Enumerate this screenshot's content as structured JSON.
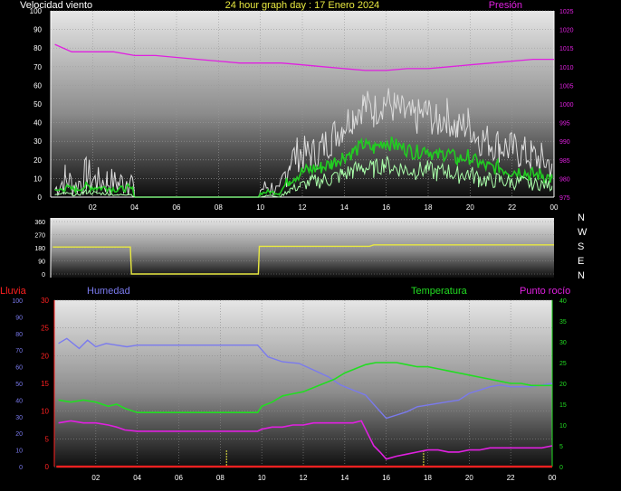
{
  "colors": {
    "background": "#000000",
    "wind_text": "#ffffff",
    "pressure": "#e020e0",
    "wind_speed": "#ffffff",
    "wind_gust": "#dcdcdc",
    "wind_avg": "#22cc22",
    "wind_low": "#aaffaa",
    "direction": "#e8e840",
    "rain": "#ff2020",
    "humidity": "#7a7aee",
    "temperature": "#22dd22",
    "dewpoint": "#e020e0",
    "title": "#e8e840"
  },
  "chart_data": [
    {
      "type": "line",
      "title": "24 hour graph day : 17 Enero 2024",
      "left_label": "Velocidad viento",
      "right_label": "Presión",
      "x_ticks": [
        "02",
        "04",
        "06",
        "08",
        "10",
        "12",
        "14",
        "16",
        "18",
        "20",
        "22",
        "00"
      ],
      "ylim": [
        0,
        100
      ],
      "y_ticks": [
        0,
        10,
        20,
        30,
        40,
        50,
        60,
        70,
        80,
        90,
        100
      ],
      "y2lim": [
        975,
        1025
      ],
      "y2_ticks": [
        975,
        980,
        985,
        990,
        995,
        1000,
        1005,
        1010,
        1015,
        1020,
        1025
      ],
      "series": [
        {
          "name": "Presión",
          "axis": "right",
          "x": [
            0.2,
            1,
            2,
            3,
            4,
            5,
            6,
            7,
            8,
            9,
            10,
            11,
            12,
            13,
            14,
            15,
            16,
            17,
            18,
            19,
            20,
            21,
            22,
            23,
            24
          ],
          "y": [
            1016,
            1014,
            1014,
            1014,
            1013,
            1013,
            1012.5,
            1012,
            1011.5,
            1011,
            1011,
            1011,
            1010.5,
            1010,
            1009.5,
            1009,
            1009,
            1009.5,
            1009.5,
            1010,
            1010.5,
            1011,
            1011.5,
            1012,
            1012
          ]
        },
        {
          "type": "gust",
          "axis": "left",
          "x": [
            0.2,
            0.7,
            1.2,
            1.7,
            2.2,
            2.7,
            3.2,
            3.7,
            3.9,
            4,
            9.9,
            10,
            10.4,
            10.9,
            11.4,
            11.9,
            12.4,
            12.9,
            13.4,
            13.9,
            14.4,
            14.9,
            15.4,
            15.9,
            16.4,
            16.9,
            17.4,
            17.9,
            18.4,
            18.9,
            19.4,
            19.9,
            20.4,
            20.9,
            21.4,
            21.9,
            22.4,
            22.9,
            23.4,
            23.9
          ],
          "y": [
            4,
            10,
            6,
            12,
            8,
            9,
            7,
            10,
            8,
            0,
            0,
            4,
            6,
            3,
            20,
            24,
            22,
            26,
            32,
            38,
            44,
            50,
            46,
            52,
            48,
            44,
            42,
            46,
            40,
            44,
            36,
            40,
            32,
            30,
            28,
            26,
            24,
            22,
            20,
            18
          ]
        },
        {
          "type": "avg",
          "axis": "left",
          "x": [
            0.2,
            0.7,
            1.2,
            1.7,
            2.2,
            2.7,
            3.2,
            3.7,
            3.9,
            4,
            9.9,
            10,
            10.4,
            10.9,
            11.4,
            11.9,
            12.4,
            12.9,
            13.4,
            13.9,
            14.4,
            14.9,
            15.4,
            15.9,
            16.4,
            16.9,
            17.4,
            17.9,
            18.4,
            18.9,
            19.4,
            19.9,
            20.4,
            20.9,
            21.4,
            21.9,
            22.4,
            22.9,
            23.4,
            23.9
          ],
          "y": [
            3,
            5,
            4,
            6,
            5,
            5,
            4,
            5,
            4,
            0,
            0,
            2,
            3,
            2,
            10,
            13,
            15,
            16,
            18,
            22,
            24,
            28,
            26,
            30,
            28,
            26,
            24,
            26,
            22,
            24,
            20,
            22,
            18,
            16,
            16,
            14,
            14,
            12,
            12,
            10
          ]
        },
        {
          "type": "low",
          "axis": "left",
          "x": [
            0.2,
            0.7,
            1.2,
            1.7,
            2.2,
            2.7,
            3.2,
            3.7,
            3.9,
            4,
            9.9,
            10,
            10.4,
            10.9,
            11.4,
            11.9,
            12.4,
            12.9,
            13.4,
            13.9,
            14.4,
            14.9,
            15.4,
            15.9,
            16.4,
            16.9,
            17.4,
            17.9,
            18.4,
            18.9,
            19.4,
            19.9,
            20.4,
            20.9,
            21.4,
            21.9,
            22.4,
            22.9,
            23.4,
            23.9
          ],
          "y": [
            1,
            2,
            1,
            3,
            2,
            2,
            1,
            2,
            1,
            0,
            0,
            0,
            1,
            0,
            4,
            6,
            8,
            9,
            10,
            12,
            14,
            16,
            15,
            18,
            16,
            15,
            14,
            15,
            13,
            14,
            12,
            13,
            10,
            9,
            9,
            8,
            8,
            7,
            7,
            6
          ]
        }
      ]
    },
    {
      "type": "line",
      "right_labels": [
        "N",
        "W",
        "S",
        "E",
        "N"
      ],
      "x_ticks": [],
      "ylim": [
        0,
        360
      ],
      "y_ticks": [
        0,
        90,
        180,
        270,
        360
      ],
      "series": [
        {
          "type": "direction",
          "x": [
            0.1,
            3.8,
            3.85,
            9.9,
            9.95,
            15.2,
            15.4,
            18.2,
            18.4,
            24
          ],
          "y": [
            185,
            185,
            0,
            0,
            190,
            190,
            200,
            200,
            200,
            200
          ]
        }
      ]
    },
    {
      "type": "line",
      "left_labels": [
        "Lluvia",
        "Humedad"
      ],
      "right_labels": [
        "Temperatura",
        "Punto rocío"
      ],
      "x_ticks": [
        "02",
        "04",
        "06",
        "08",
        "10",
        "12",
        "14",
        "16",
        "18",
        "20",
        "22",
        "00"
      ],
      "left_outer_ticks": [
        0,
        10,
        20,
        30,
        40,
        50,
        60,
        70,
        80,
        90,
        100
      ],
      "left_inner_ticks": [
        0,
        5,
        10,
        15,
        20,
        25,
        30
      ],
      "right_ticks": [
        0,
        5,
        10,
        15,
        20,
        25,
        30,
        35,
        40
      ],
      "markers_x": [
        8.3,
        17.8
      ],
      "series": [
        {
          "name": "Humedad",
          "axis": "humidity",
          "x": [
            0.2,
            0.6,
            1.2,
            1.6,
            2.0,
            2.5,
            3.0,
            3.5,
            4,
            5,
            6,
            7,
            8,
            9,
            9.8,
            10.3,
            11,
            11.8,
            12.5,
            13.2,
            13.8,
            14.4,
            15,
            15.5,
            16,
            16.5,
            17,
            17.5,
            18,
            18.5,
            19,
            19.5,
            20,
            20.5,
            21,
            21.5,
            22,
            22.5,
            23,
            23.5,
            24
          ],
          "y": [
            74,
            77,
            71,
            76,
            72,
            74,
            73,
            72,
            73,
            73,
            73,
            73,
            73,
            73,
            73,
            66,
            63,
            62,
            58,
            54,
            49,
            46,
            43,
            36,
            29,
            31,
            33,
            36,
            37,
            38,
            39,
            40,
            44,
            46,
            48,
            49,
            48,
            48,
            48,
            49,
            50
          ]
        },
        {
          "name": "Temperatura",
          "axis": "temp",
          "x": [
            0.2,
            0.8,
            1.4,
            2.0,
            2.6,
            3.0,
            3.4,
            4,
            5,
            6,
            7,
            8,
            9,
            9.8,
            10,
            10.5,
            11,
            11.5,
            12,
            12.5,
            13,
            13.5,
            14,
            14.5,
            15,
            15.5,
            16,
            16.5,
            17,
            17.5,
            18,
            18.5,
            19,
            19.5,
            20,
            20.5,
            21,
            21.5,
            22,
            22.5,
            23,
            23.5,
            24
          ],
          "y": [
            16,
            15.5,
            16,
            15.5,
            14.5,
            15,
            14,
            13,
            13,
            13,
            13,
            13,
            13,
            13,
            14.5,
            15.5,
            17,
            17.5,
            18,
            19,
            20,
            21,
            22.5,
            23.5,
            24.5,
            25,
            25,
            25,
            24.5,
            24,
            24,
            23.5,
            23,
            22.5,
            22,
            21.5,
            21,
            20.5,
            20,
            20,
            19.5,
            19.5,
            19.5
          ]
        },
        {
          "name": "Punto rocío",
          "axis": "temp",
          "x": [
            0.2,
            0.8,
            1.4,
            2.0,
            2.6,
            3.0,
            3.4,
            4,
            5,
            6,
            7,
            8,
            9,
            9.8,
            10,
            10.5,
            11,
            11.5,
            12,
            12.5,
            13,
            13.5,
            14,
            14.4,
            14.8,
            15.1,
            15.4,
            15.7,
            16,
            16.5,
            17,
            17.5,
            18,
            18.5,
            19,
            19.5,
            20,
            20.5,
            21,
            21.5,
            22,
            22.5,
            23,
            23.5,
            24
          ],
          "y": [
            10.5,
            11,
            10.5,
            10.5,
            10,
            9.5,
            8.8,
            8.5,
            8.5,
            8.5,
            8.5,
            8.5,
            8.5,
            8.5,
            9,
            9.5,
            9.5,
            10,
            10,
            10.5,
            10.5,
            10.5,
            10.5,
            10.5,
            11,
            8,
            5,
            3.5,
            1.8,
            2.5,
            3,
            3.5,
            4,
            4,
            3.5,
            3.5,
            4,
            4,
            4.5,
            4.5,
            4.5,
            4.5,
            4.5,
            4.5,
            5
          ]
        },
        {
          "name": "Lluvia",
          "axis": "rain",
          "x": [
            0.1,
            24
          ],
          "y": [
            0,
            0
          ]
        }
      ]
    }
  ]
}
